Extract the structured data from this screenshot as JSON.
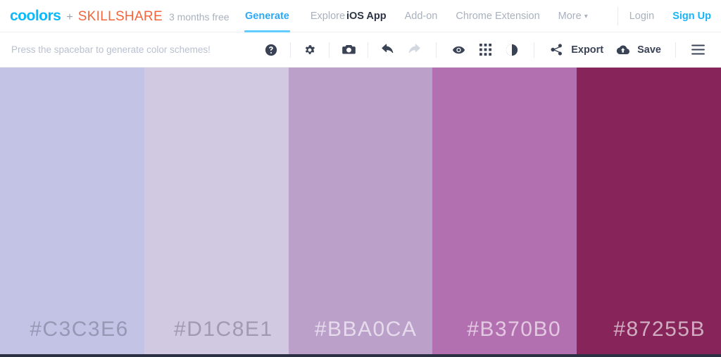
{
  "header": {
    "logo_primary": "coolors",
    "logo_plus": "+",
    "logo_secondary": "SKILLSHARE",
    "promo": "3 months free",
    "tabs": [
      {
        "label": "Generate",
        "active": true
      },
      {
        "label": "Explore",
        "active": false
      }
    ],
    "nav_links": [
      {
        "label": "iOS App",
        "style": "dark"
      },
      {
        "label": "Add-on",
        "style": "muted"
      },
      {
        "label": "Chrome Extension",
        "style": "muted"
      },
      {
        "label": "More",
        "style": "muted",
        "caret": "▾"
      }
    ],
    "account": [
      {
        "label": "Login",
        "style": "muted"
      },
      {
        "label": "Sign Up",
        "style": "blue"
      }
    ]
  },
  "toolbar": {
    "hint": "Press the spacebar to generate color schemes!",
    "buttons": [
      {
        "name": "help-icon",
        "title": "Help",
        "enabled": true
      },
      {
        "name": "gear-icon",
        "title": "Settings",
        "enabled": true
      },
      {
        "name": "camera-icon",
        "title": "Snapshot",
        "enabled": true
      },
      {
        "name": "undo-icon",
        "title": "Undo",
        "enabled": true
      },
      {
        "name": "redo-icon",
        "title": "Redo",
        "enabled": false
      },
      {
        "name": "eye-icon",
        "title": "View",
        "enabled": true
      },
      {
        "name": "grid-icon",
        "title": "Grid view",
        "enabled": true
      },
      {
        "name": "contrast-icon",
        "title": "Adjust",
        "enabled": true
      }
    ],
    "export_label": "Export",
    "save_label": "Save",
    "menu_label": "Menu"
  },
  "palette": {
    "swatches": [
      {
        "hex": "#C3C3E6",
        "label": "#C3C3E6",
        "text": "dark"
      },
      {
        "hex": "#D1C8E1",
        "label": "#D1C8E1",
        "text": "dark"
      },
      {
        "hex": "#BBA0CA",
        "label": "#BBA0CA",
        "text": "light"
      },
      {
        "hex": "#B370B0",
        "label": "#B370B0",
        "text": "light"
      },
      {
        "hex": "#87255B",
        "label": "#87255B",
        "text": "light"
      }
    ]
  },
  "colors": {
    "brand_blue": "#0cb9fd",
    "brand_orange": "#f4653b",
    "accent_blue": "#18b4fb",
    "icon_dark": "#3a4356",
    "muted_text": "#a9b1bd",
    "footer": "#2b3142"
  }
}
